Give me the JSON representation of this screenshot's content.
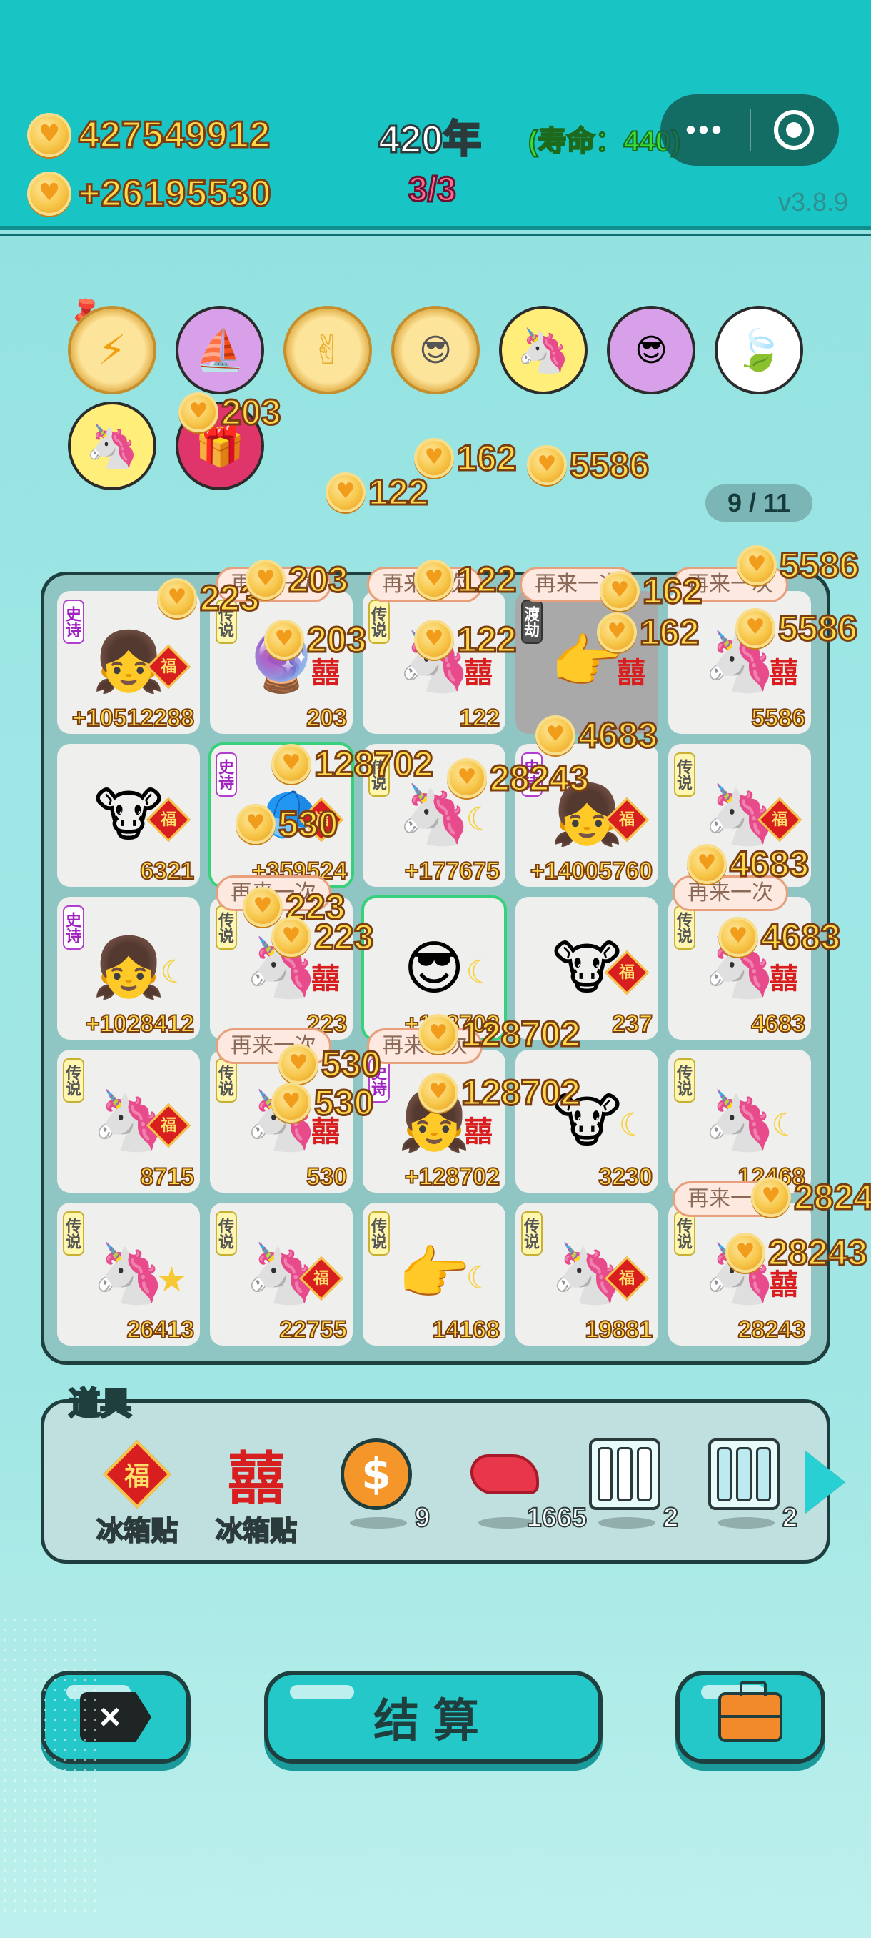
{
  "header": {
    "coins_total": "427549912",
    "coins_income": "+26195530",
    "year": "420年",
    "lifespan": "(寿命：440)",
    "round": "3/3",
    "version": "v3.8.9"
  },
  "buffs": [
    "lightning",
    "skirt",
    "rock-hand",
    "math-face",
    "unicorn",
    "math-face-2",
    "leaf",
    "unicorn-2",
    "gift-box"
  ],
  "page_indicator": "9 / 11",
  "grid": {
    "cells": [
      {
        "tag": "史诗",
        "art": "girl",
        "badge": "福",
        "value": "+10512288"
      },
      {
        "tag": "传说",
        "art": "crystal-ball",
        "badge": "囍",
        "value": "203"
      },
      {
        "tag": "传说",
        "art": "unicorn",
        "badge": "囍",
        "value": "122"
      },
      {
        "tag": "渡劫",
        "art": "hand-pointer",
        "badge": "囍",
        "value": ""
      },
      {
        "tag": "",
        "art": "unicorn",
        "badge": "囍",
        "value": "5586"
      },
      {
        "tag": "",
        "art": "cow",
        "badge": "福",
        "value": "6321"
      },
      {
        "tag": "史诗",
        "art": "green-cap-guy",
        "badge": "福",
        "value": "+359524"
      },
      {
        "tag": "传说",
        "art": "unicorn",
        "badge": "moon",
        "value": "+177675"
      },
      {
        "tag": "史诗",
        "art": "girl",
        "badge": "福",
        "value": "+14005760"
      },
      {
        "tag": "传说",
        "art": "unicorn",
        "badge": "福",
        "value": ""
      },
      {
        "tag": "史诗",
        "art": "girl",
        "badge": "moon",
        "value": "+1028412"
      },
      {
        "tag": "传说",
        "art": "unicorn",
        "badge": "囍",
        "value": "223"
      },
      {
        "tag": "",
        "art": "sunglasses-guy",
        "badge": "moon",
        "value": "+128702"
      },
      {
        "tag": "",
        "art": "cow",
        "badge": "福",
        "value": "237"
      },
      {
        "tag": "传说",
        "art": "unicorn",
        "badge": "囍",
        "value": "4683"
      },
      {
        "tag": "传说",
        "art": "unicorn",
        "badge": "福",
        "value": "8715"
      },
      {
        "tag": "传说",
        "art": "unicorn",
        "badge": "囍",
        "value": "530"
      },
      {
        "tag": "史诗",
        "art": "girl",
        "badge": "囍",
        "value": "+128702"
      },
      {
        "tag": "",
        "art": "cow",
        "badge": "moon",
        "value": "3230"
      },
      {
        "tag": "传说",
        "art": "unicorn",
        "badge": "moon",
        "value": "12468"
      },
      {
        "tag": "传说",
        "art": "unicorn",
        "badge": "star",
        "value": "26413"
      },
      {
        "tag": "传说",
        "art": "unicorn",
        "badge": "福",
        "value": "22755"
      },
      {
        "tag": "传说",
        "art": "hand-pointer",
        "badge": "moon",
        "value": "14168"
      },
      {
        "tag": "传说",
        "art": "unicorn",
        "badge": "福",
        "value": "19881"
      },
      {
        "tag": "传说",
        "art": "unicorn",
        "badge": "囍",
        "value": "28243"
      }
    ],
    "retry_label": "再来一次"
  },
  "floats": [
    "203",
    "162",
    "5586",
    "122",
    "223",
    "203",
    "122",
    "162",
    "5586",
    "203",
    "122",
    "162",
    "5586",
    "4683",
    "128702",
    "28243",
    "530",
    "4683",
    "223",
    "223",
    "4683",
    "128702",
    "530",
    "530",
    "128702",
    "2824",
    "28243"
  ],
  "items": {
    "title": "道具",
    "list": [
      {
        "icon": "fu-sticker",
        "label": "冰箱贴",
        "count": ""
      },
      {
        "icon": "xi-sticker",
        "label": "冰箱贴",
        "count": ""
      },
      {
        "icon": "dollar-coin",
        "label": "",
        "count": "9"
      },
      {
        "icon": "liver",
        "label": "",
        "count": "1665"
      },
      {
        "icon": "fridge-3",
        "label": "",
        "count": "2"
      },
      {
        "icon": "fridge-full",
        "label": "",
        "count": "2"
      }
    ]
  },
  "buttons": {
    "settle": "结算"
  }
}
